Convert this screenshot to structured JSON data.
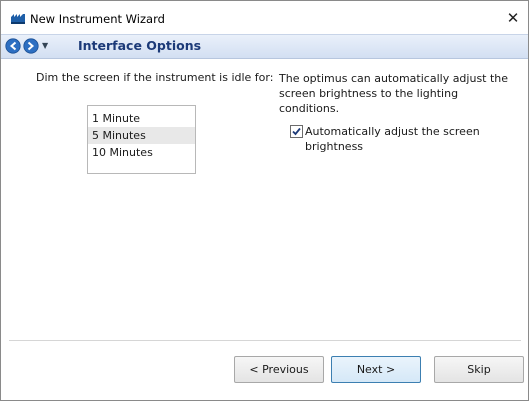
{
  "window": {
    "title": "New Instrument Wizard",
    "close_glyph": "✕"
  },
  "nav": {
    "title": "Interface Options",
    "dropdown_glyph": "▼"
  },
  "dim": {
    "label": "Dim the screen if the instrument is idle for:",
    "options": [
      "1 Minute",
      "5 Minutes",
      "10 Minutes"
    ],
    "selected": "5 Minutes"
  },
  "brightness": {
    "description": "The optimus can automatically adjust the screen brightness to the lighting conditions.",
    "checkbox_label": "Automatically adjust the screen brightness",
    "checked": true
  },
  "buttons": {
    "previous": "< Previous",
    "next": "Next >",
    "skip": "Skip"
  },
  "colors": {
    "accent": "#1c3a78",
    "nav_arrow": "#2d6fc2"
  }
}
